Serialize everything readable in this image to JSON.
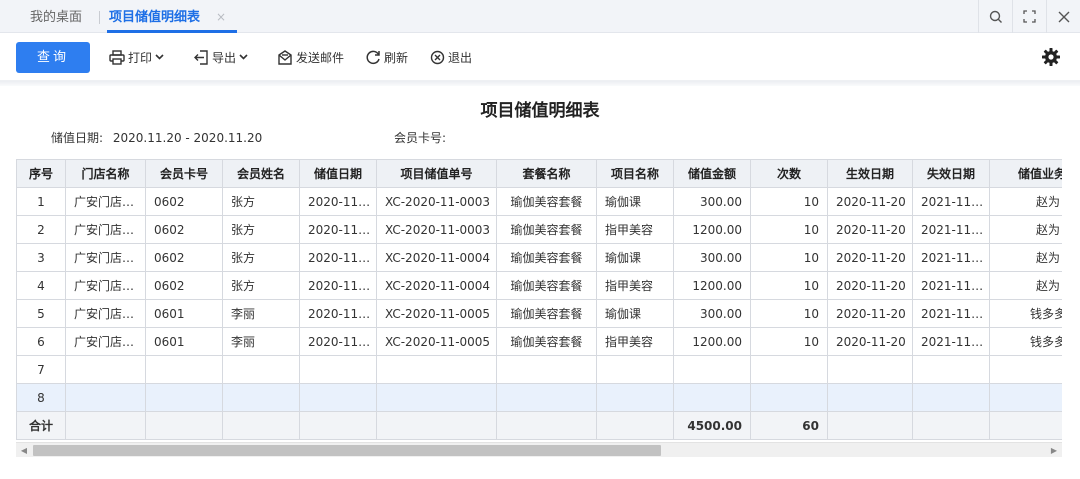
{
  "tabs": {
    "home_label": "我的桌面",
    "active_label": "项目储值明细表",
    "close_glyph": "×"
  },
  "toolbar": {
    "query_label": "查询",
    "print_label": "打印",
    "export_label": "导出",
    "mail_label": "发送邮件",
    "refresh_label": "刷新",
    "exit_label": "退出"
  },
  "report": {
    "title": "项目储值明细表",
    "date_label": "储值日期:",
    "date_value": "2020.11.20 - 2020.11.20",
    "card_label": "会员卡号:",
    "card_value": ""
  },
  "table": {
    "headers": [
      "序号",
      "门店名称",
      "会员卡号",
      "会员姓名",
      "储值日期",
      "项目储值单号",
      "套餐名称",
      "项目名称",
      "储值金额",
      "次数",
      "生效日期",
      "失效日期",
      "储值业务员"
    ],
    "rows": [
      [
        "1",
        "广安门店…",
        "0602",
        "张方",
        "2020-11…",
        "XC-2020-11-0003",
        "瑜伽美容套餐",
        "瑜伽课",
        "300.00",
        "10",
        "2020-11-20",
        "2021-11…",
        "赵为"
      ],
      [
        "2",
        "广安门店…",
        "0602",
        "张方",
        "2020-11…",
        "XC-2020-11-0003",
        "瑜伽美容套餐",
        "指甲美容",
        "1200.00",
        "10",
        "2020-11-20",
        "2021-11…",
        "赵为"
      ],
      [
        "3",
        "广安门店…",
        "0602",
        "张方",
        "2020-11…",
        "XC-2020-11-0004",
        "瑜伽美容套餐",
        "瑜伽课",
        "300.00",
        "10",
        "2020-11-20",
        "2021-11…",
        "赵为"
      ],
      [
        "4",
        "广安门店…",
        "0602",
        "张方",
        "2020-11…",
        "XC-2020-11-0004",
        "瑜伽美容套餐",
        "指甲美容",
        "1200.00",
        "10",
        "2020-11-20",
        "2021-11…",
        "赵为"
      ],
      [
        "5",
        "广安门店…",
        "0601",
        "李丽",
        "2020-11…",
        "XC-2020-11-0005",
        "瑜伽美容套餐",
        "瑜伽课",
        "300.00",
        "10",
        "2020-11-20",
        "2021-11…",
        "钱多多"
      ],
      [
        "6",
        "广安门店…",
        "0601",
        "李丽",
        "2020-11…",
        "XC-2020-11-0005",
        "瑜伽美容套餐",
        "指甲美容",
        "1200.00",
        "10",
        "2020-11-20",
        "2021-11…",
        "钱多多"
      ],
      [
        "7",
        "",
        "",
        "",
        "",
        "",
        "",
        "",
        "",
        "",
        "",
        "",
        ""
      ],
      [
        "8",
        "",
        "",
        "",
        "",
        "",
        "",
        "",
        "",
        "",
        "",
        "",
        ""
      ]
    ],
    "total": [
      "合计",
      "",
      "",
      "",
      "",
      "",
      "",
      "",
      "4500.00",
      "60",
      "",
      "",
      ""
    ]
  },
  "icons": [
    "search-icon",
    "maximize-icon",
    "close-icon",
    "printer-icon",
    "export-icon",
    "mail-icon",
    "refresh-icon",
    "exit-icon",
    "gear-icon",
    "chevron-down-icon"
  ],
  "colors": {
    "accent": "#2e7ef0",
    "active_tab": "#1e6fe6",
    "header_bg": "#eef1f5",
    "highlight_row": "#e9f1fc"
  }
}
